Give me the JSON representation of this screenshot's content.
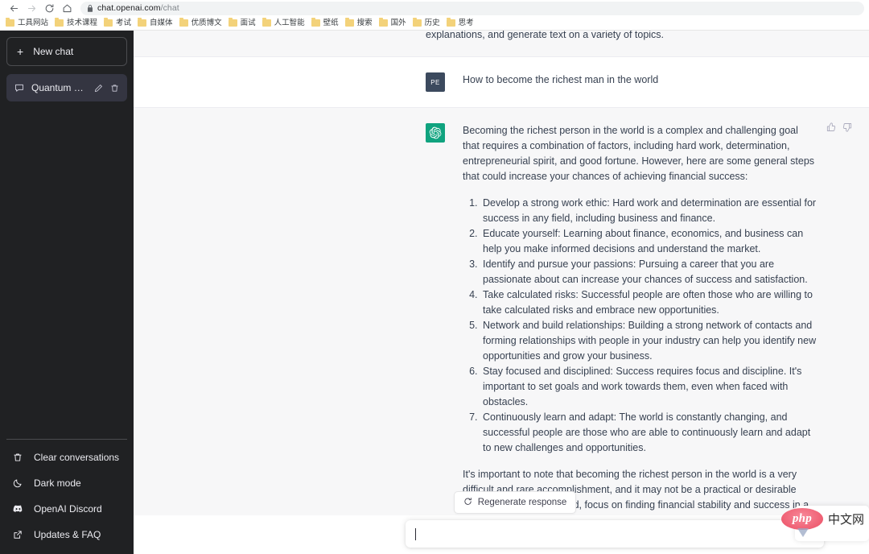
{
  "browser": {
    "url_host": "chat.openai.com",
    "url_path": "/chat",
    "back_icon": "back-arrow-icon",
    "forward_icon": "forward-arrow-icon",
    "reload_icon": "reload-icon",
    "home_icon": "home-icon",
    "lock_icon": "lock-icon",
    "bookmarks": [
      {
        "label": "工具网站"
      },
      {
        "label": "技术课程"
      },
      {
        "label": "考试"
      },
      {
        "label": "自媒体"
      },
      {
        "label": "优质博文"
      },
      {
        "label": "面试"
      },
      {
        "label": "人工智能"
      },
      {
        "label": "壁纸"
      },
      {
        "label": "搜索"
      },
      {
        "label": "国外"
      },
      {
        "label": "历史"
      },
      {
        "label": "思考"
      }
    ]
  },
  "sidebar": {
    "new_chat_label": "New chat",
    "new_chat_plus": "+",
    "conversations": [
      {
        "title": "Quantum Computing",
        "active": true
      }
    ],
    "footer_items": [
      {
        "label": "Clear conversations",
        "icon": "trash-icon"
      },
      {
        "label": "Dark mode",
        "icon": "moon-icon"
      },
      {
        "label": "OpenAI Discord",
        "icon": "discord-icon"
      },
      {
        "label": "Updates & FAQ",
        "icon": "external-link-icon"
      }
    ],
    "bg_color": "#202123",
    "active_color": "#343541"
  },
  "chat": {
    "partial_message": {
      "role": "assistant",
      "text": "explanations, and generate text on a variety of topics."
    },
    "user_message": {
      "role": "user",
      "avatar_initials": "PE",
      "avatar_color": "#3c4a5e",
      "text": "How to become the richest man in the world"
    },
    "assistant_message": {
      "role": "assistant",
      "avatar_color": "#10a37f",
      "intro": "Becoming the richest person in the world is a complex and challenging goal that requires a combination of factors, including hard work, determination, entrepreneurial spirit, and good fortune. However, here are some general steps that could increase your chances of achieving financial success:",
      "steps": [
        "Develop a strong work ethic: Hard work and determination are essential for success in any field, including business and finance.",
        "Educate yourself: Learning about finance, economics, and business can help you make informed decisions and understand the market.",
        "Identify and pursue your passions: Pursuing a career that you are passionate about can increase your chances of success and satisfaction.",
        "Take calculated risks: Successful people are often those who are willing to take calculated risks and embrace new opportunities.",
        "Network and build relationships: Building a strong network of contacts and forming relationships with people in your industry can help you identify new opportunities and grow your business.",
        "Stay focused and disciplined: Success requires focus and discipline. It's important to set goals and work towards them, even when faced with obstacles.",
        "Continuously learn and adapt: The world is constantly changing, and successful people are those who are able to continuously learn and adapt to new challenges and opportunities."
      ],
      "outro": "It's important to note that becoming the richest person in the world is a very difficult and rare accomplishment, and it may not be a practical or desirable goal for everyone. Instead, focus on finding financial stability and success in a way that aligns with your values and passions.",
      "thumbs_up_icon": "thumbs-up-icon",
      "thumbs_down_icon": "thumbs-down-icon"
    }
  },
  "composer": {
    "regenerate_label": "Regenerate response",
    "regenerate_icon": "refresh-icon",
    "input_value": "",
    "input_placeholder": "",
    "send_icon": "send-icon"
  },
  "watermark": {
    "logo_text": "php",
    "site_text": "中文网"
  }
}
